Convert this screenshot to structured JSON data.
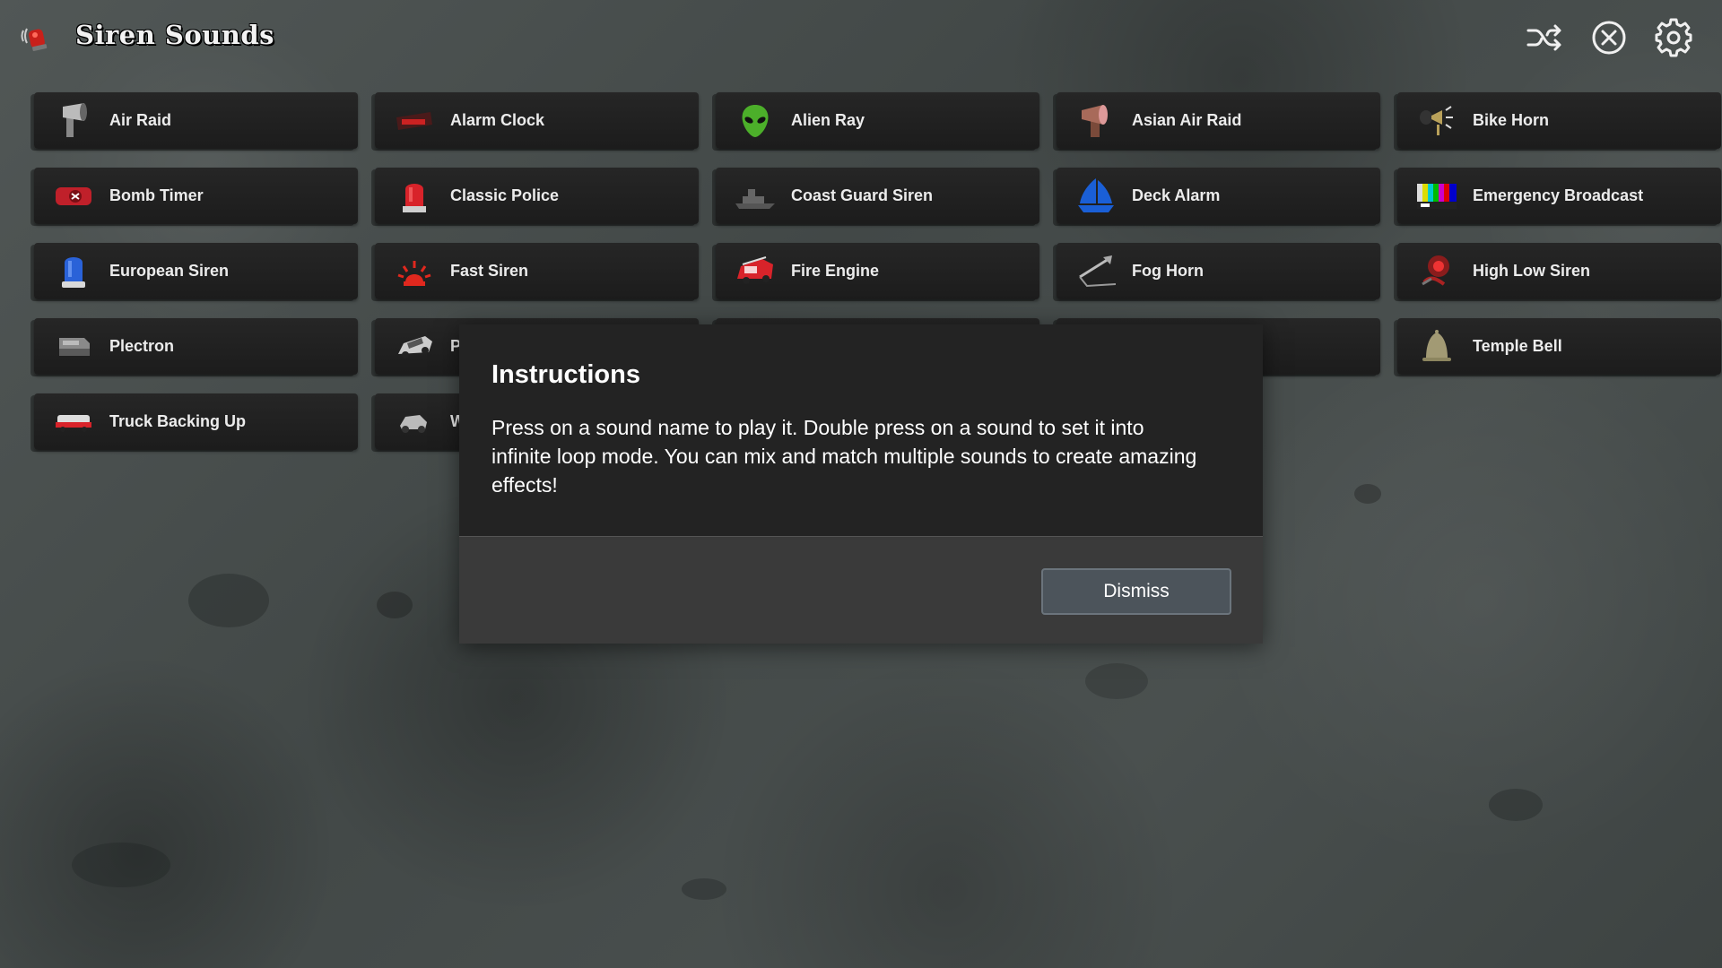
{
  "header": {
    "title": "Siren Sounds",
    "logo_icon": "siren-app-logo",
    "actions": [
      {
        "name": "shuffle",
        "icon": "shuffle-icon"
      },
      {
        "name": "stop-all",
        "icon": "close-circle-icon"
      },
      {
        "name": "settings",
        "icon": "gear-icon"
      }
    ]
  },
  "sounds": [
    {
      "label": "Air Raid",
      "icon": "loudspeaker-siren-icon"
    },
    {
      "label": "Alarm Clock",
      "icon": "alarm-clock-icon"
    },
    {
      "label": "Alien Ray",
      "icon": "alien-head-icon"
    },
    {
      "label": "Asian Air Raid",
      "icon": "air-raid-horn-icon"
    },
    {
      "label": "Bike Horn",
      "icon": "bike-horn-icon"
    },
    {
      "label": "Bomb Timer",
      "icon": "bomb-timer-icon"
    },
    {
      "label": "Classic Police",
      "icon": "red-police-light-icon"
    },
    {
      "label": "Coast Guard Siren",
      "icon": "ship-icon"
    },
    {
      "label": "Deck Alarm",
      "icon": "blue-sail-icon"
    },
    {
      "label": "Emergency Broadcast",
      "icon": "color-bars-icon"
    },
    {
      "label": "European Siren",
      "icon": "blue-police-light-icon"
    },
    {
      "label": "Fast Siren",
      "icon": "flashing-light-icon"
    },
    {
      "label": "Fire Engine",
      "icon": "fire-truck-icon"
    },
    {
      "label": "Fog Horn",
      "icon": "fog-horn-icon"
    },
    {
      "label": "High Low Siren",
      "icon": "red-siren-speaker-icon"
    },
    {
      "label": "Plectron",
      "icon": "radio-receiver-icon"
    },
    {
      "label": "P",
      "icon": "police-car-icon"
    },
    {
      "label": "",
      "icon": ""
    },
    {
      "label": "",
      "icon": ""
    },
    {
      "label": "Temple Bell",
      "icon": "bell-icon"
    },
    {
      "label": "Truck Backing Up",
      "icon": "truck-icon"
    },
    {
      "label": "W",
      "icon": "vehicle-icon"
    }
  ],
  "dialog": {
    "title": "Instructions",
    "body": "Press on a sound name to play it. Double press on a sound to set it into infinite loop mode. You can mix and match multiple sounds to create amazing effects!",
    "dismiss_label": "Dismiss"
  },
  "colors": {
    "button_bg": "#232323",
    "dialog_bg": "#232323",
    "dialog_footer_bg": "#3a3a3a",
    "dismiss_bg": "#4c545b"
  }
}
